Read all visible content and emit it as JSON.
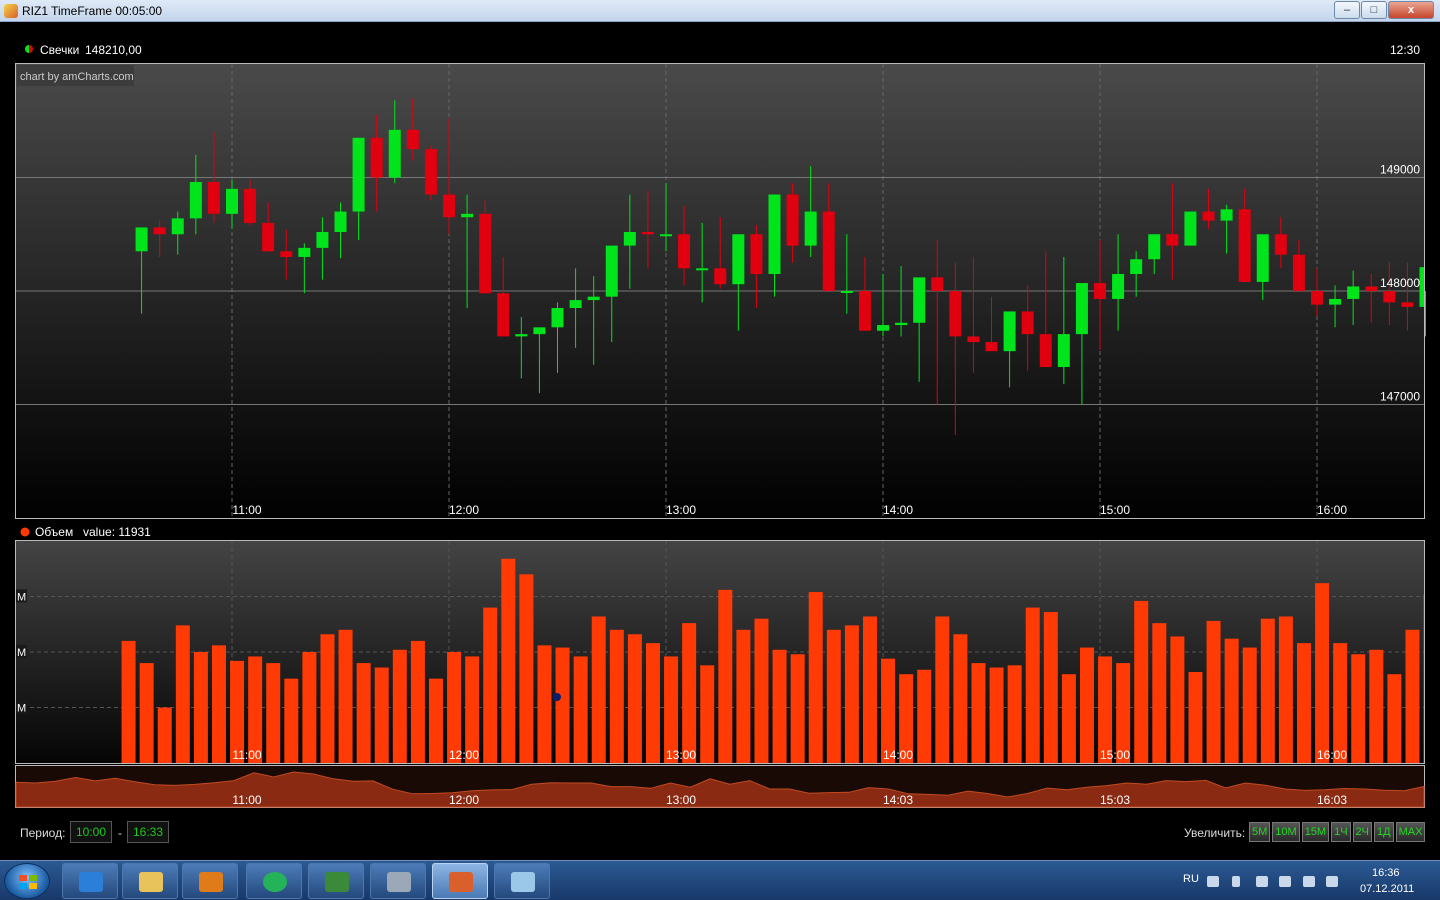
{
  "window": {
    "title": "RIZ1 TimeFrame 00:05:00",
    "minimize_glyph": "–",
    "maximize_glyph": "□",
    "close_glyph": "x"
  },
  "colors": {
    "bull": "#00e41b",
    "bear": "#e0000f",
    "volume": "#ff3a05",
    "text": "#ffffff",
    "grid": "#666666"
  },
  "price_panel": {
    "legend_label": "Свечки",
    "legend_value": "148210,00",
    "time_readout": "12:30",
    "credit": "chart by amCharts.com"
  },
  "volume_panel": {
    "legend_label": "Объем",
    "legend_value": "value: 11931",
    "axis_marks": [
      "M",
      "M",
      "M"
    ]
  },
  "controls": {
    "period_label": "Период:",
    "period_from": "10:00",
    "period_dash": "-",
    "period_to": "16:33",
    "zoom_label": "Увеличить:",
    "zoom_buttons": [
      "5M",
      "10M",
      "15M",
      "1Ч",
      "2Ч",
      "1Д",
      "MAX"
    ]
  },
  "taskbar": {
    "lang": "RU",
    "time": "16:36",
    "date": "07.12.2011"
  },
  "chart_data": [
    {
      "type": "candlestick",
      "x": [
        "10:35",
        "10:40",
        "10:45",
        "10:50",
        "10:55",
        "11:00",
        "11:05",
        "11:10",
        "11:15",
        "11:20",
        "11:25",
        "11:30",
        "11:35",
        "11:40",
        "11:45",
        "11:50",
        "11:55",
        "12:00",
        "12:05",
        "12:10",
        "12:15",
        "12:20",
        "12:25",
        "12:30",
        "12:35",
        "12:40",
        "12:45",
        "12:50",
        "12:55",
        "13:00",
        "13:05",
        "13:10",
        "13:15",
        "13:20",
        "13:25",
        "13:30",
        "13:35",
        "13:40",
        "13:45",
        "13:50",
        "13:55",
        "14:00",
        "14:05",
        "14:10",
        "14:15",
        "14:20",
        "14:25",
        "14:30",
        "14:35",
        "14:40",
        "14:45",
        "14:50",
        "14:55",
        "15:00",
        "15:05",
        "15:10",
        "15:15",
        "15:20",
        "15:25",
        "15:30",
        "15:35",
        "15:40",
        "15:45",
        "15:50",
        "15:55",
        "16:00",
        "16:05",
        "16:10",
        "16:15",
        "16:20",
        "16:25",
        "16:30"
      ],
      "open": [
        148350,
        148560,
        148500,
        148640,
        148960,
        148680,
        148900,
        148600,
        148350,
        148300,
        148380,
        148520,
        148700,
        149350,
        149000,
        149420,
        149250,
        148850,
        148650,
        148680,
        147980,
        147600,
        147620,
        147680,
        147850,
        147920,
        147950,
        148400,
        148520,
        148500,
        148500,
        148200,
        148200,
        148060,
        148500,
        148150,
        148850,
        148400,
        148700,
        148000,
        148000,
        147650,
        147700,
        147720,
        148120,
        148000,
        147600,
        147550,
        147470,
        147820,
        147620,
        147330,
        147620,
        148070,
        147930,
        148150,
        148280,
        148500,
        148400,
        148700,
        148620,
        148720,
        148080,
        148500,
        148320,
        148000,
        147880,
        147930,
        148040,
        148000,
        147900,
        147860
      ],
      "high": [
        148480,
        148620,
        148700,
        149200,
        149400,
        148980,
        148980,
        148780,
        148540,
        148420,
        148650,
        148780,
        149050,
        149550,
        149680,
        149700,
        149280,
        149520,
        148850,
        148800,
        148300,
        147770,
        147680,
        147900,
        148200,
        148130,
        148260,
        148850,
        148880,
        148950,
        148750,
        148600,
        148650,
        148400,
        148580,
        148600,
        148950,
        149100,
        148950,
        148500,
        148300,
        148150,
        148220,
        148020,
        148450,
        148250,
        148300,
        147950,
        147820,
        148050,
        148350,
        148300,
        147870,
        148450,
        148500,
        148350,
        148500,
        148950,
        148700,
        148900,
        148760,
        148900,
        148350,
        148650,
        148450,
        148200,
        148050,
        148180,
        148150,
        148250,
        148250,
        148000
      ],
      "low": [
        147800,
        148300,
        148320,
        148500,
        148600,
        148550,
        148580,
        148350,
        148100,
        147980,
        148100,
        148290,
        148450,
        148700,
        148950,
        149150,
        148800,
        148500,
        147850,
        148500,
        147700,
        147230,
        147100,
        147280,
        147500,
        147350,
        147550,
        148020,
        148200,
        148350,
        148050,
        147900,
        148020,
        147650,
        147850,
        147950,
        148250,
        148300,
        148350,
        147800,
        147750,
        147600,
        147600,
        147200,
        147000,
        146730,
        147280,
        147470,
        147150,
        147300,
        147500,
        147180,
        147000,
        147480,
        147650,
        147950,
        148150,
        148100,
        148400,
        148550,
        148330,
        148600,
        147920,
        148200,
        148000,
        147780,
        147680,
        147700,
        147720,
        147700,
        147650,
        147600
      ],
      "close": [
        148560,
        148500,
        148640,
        148960,
        148680,
        148900,
        148600,
        148350,
        148300,
        148380,
        148520,
        148700,
        149350,
        149000,
        149420,
        149250,
        148850,
        148650,
        148680,
        147980,
        147600,
        147620,
        147680,
        147850,
        147920,
        147950,
        148400,
        148520,
        148500,
        148500,
        148200,
        148200,
        148060,
        148500,
        148150,
        148850,
        148400,
        148700,
        148000,
        148000,
        147650,
        147700,
        147720,
        148120,
        148000,
        147600,
        147550,
        147470,
        147820,
        147620,
        147330,
        147620,
        148070,
        147930,
        148150,
        148280,
        148500,
        148400,
        148700,
        148620,
        148720,
        148080,
        148500,
        148320,
        148000,
        147880,
        147930,
        148040,
        148000,
        147900,
        147860,
        148210
      ],
      "x_ticks": [
        "11:00",
        "12:00",
        "13:00",
        "14:00",
        "15:00",
        "16:00"
      ],
      "y_ticks": [
        149000,
        148000,
        147000
      ],
      "ylim": [
        146000,
        150000
      ],
      "grid": true
    },
    {
      "type": "bar",
      "x_ticks": [
        "11:00",
        "12:00",
        "13:00",
        "14:00",
        "15:00",
        "16:00"
      ],
      "values": [
        55,
        45,
        25,
        62,
        50,
        53,
        46,
        48,
        45,
        38,
        50,
        58,
        60,
        45,
        43,
        51,
        55,
        38,
        50,
        48,
        70,
        92,
        85,
        53,
        52,
        48,
        66,
        60,
        58,
        54,
        48,
        63,
        44,
        78,
        60,
        65,
        51,
        49,
        77,
        60,
        62,
        66,
        47,
        40,
        42,
        66,
        58,
        45,
        43,
        44,
        70,
        68,
        40,
        52,
        48,
        45,
        73,
        63,
        57,
        41,
        64,
        56,
        52,
        65,
        66,
        54,
        81,
        54,
        49,
        51,
        40,
        60,
        76
      ],
      "vmax": 100,
      "navigator_x_ticks": [
        "11:00",
        "12:00",
        "13:00",
        "14:03",
        "15:03",
        "16:03"
      ]
    }
  ]
}
